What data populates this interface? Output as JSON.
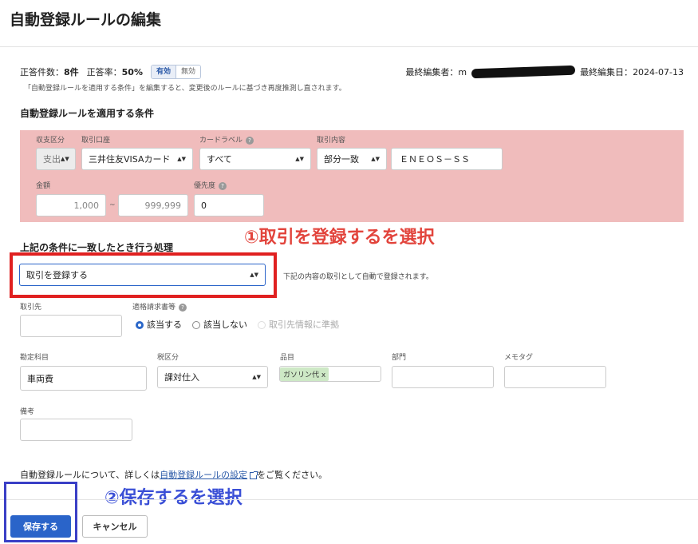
{
  "page": {
    "title": "自動登録ルールの編集"
  },
  "stats": {
    "correct_count_label": "正答件数：",
    "correct_count": "8件",
    "correct_rate_label": "正答率：",
    "correct_rate": "50%",
    "toggle_on": "有効",
    "toggle_off": "無効",
    "last_editor_label": "最終編集者：",
    "last_editor_suffix": "m",
    "last_edited_label": "最終編集日：",
    "last_edited_date": "2024-07-13"
  },
  "note": "「自動登録ルールを適用する条件」を編集すると、変更後のルールに基づき再度推測し直されます。",
  "conditions": {
    "heading": "自動登録ルールを適用する条件",
    "type_label": "収支区分",
    "type_value": "支出",
    "account_label": "取引口座",
    "account_value": "三井住友VISAカード",
    "card_label_label": "カードラベル",
    "card_label_value": "すべて",
    "content_label": "取引内容",
    "match_value": "部分一致",
    "content_value": "ＥＮＥＯＳ－ＳＳ",
    "amount_label": "金額",
    "amount_min": "1,000",
    "amount_sep": "~",
    "amount_max": "999,999",
    "priority_label": "優先度",
    "priority_value": "0"
  },
  "action": {
    "heading": "上記の条件に一致したとき行う処理",
    "select_value": "取引を登録する",
    "select_note": "下記の内容の取引として自動で登録されます。"
  },
  "details": {
    "partner_label": "取引先",
    "invoice_label": "適格請求書等",
    "radio_yes": "該当する",
    "radio_no": "該当しない",
    "radio_follow": "取引先情報に準拠",
    "account_item_label": "勘定科目",
    "account_item_value": "車両費",
    "tax_label": "税区分",
    "tax_value": "課対仕入",
    "item_label": "品目",
    "item_tag": "ガソリン代 x",
    "dept_label": "部門",
    "memo_label": "メモタグ",
    "remarks_label": "備考"
  },
  "footer": {
    "info_prefix": "自動登録ルールについて、詳しくは",
    "info_link": "自動登録ルールの設定",
    "info_suffix": "をご覧ください。",
    "save_label": "保存する",
    "cancel_label": "キャンセル"
  },
  "annotations": {
    "step1": "①取引を登録するを選択",
    "step2": "②保存するを選択"
  },
  "colors": {
    "condition_panel": "#f0bcbc",
    "primary": "#2a64c9",
    "annotation_red": "#e2443c",
    "annotation_blue": "#3a4fd6"
  }
}
